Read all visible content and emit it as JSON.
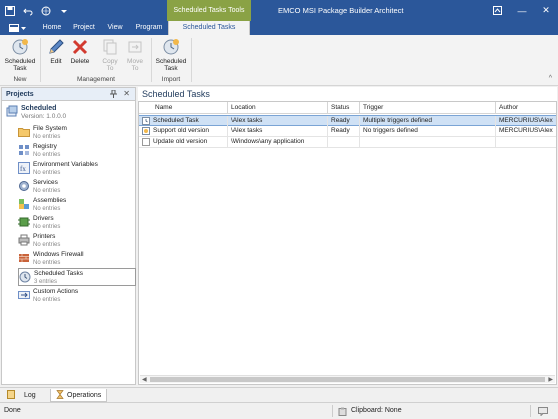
{
  "titlebar": {
    "tools_tab": "Scheduled Tasks Tools",
    "app_title": "EMCO MSI Package Builder Architect",
    "minimize_glyph": "—",
    "restore_glyph": "❐",
    "close_glyph": "✕"
  },
  "tabs": [
    {
      "label": "Home"
    },
    {
      "label": "Project"
    },
    {
      "label": "View"
    },
    {
      "label": "Program"
    },
    {
      "label": "Scheduled Tasks",
      "active": true
    }
  ],
  "ribbon": {
    "new_group": {
      "label": "New",
      "scheduled_task": "Scheduled\nTask"
    },
    "management_group": {
      "label": "Management",
      "edit": "Edit",
      "delete": "Delete",
      "copy_to": "Copy\nTo",
      "move_to": "Move\nTo"
    },
    "import_group": {
      "label": "Import",
      "scheduled_task": "Scheduled\nTask"
    },
    "collapse_glyph": "^"
  },
  "projects_pane": {
    "title": "Projects",
    "pin_glyph": "📌",
    "close_glyph": "✕",
    "root": {
      "name": "Scheduled",
      "version": "Version: 1.0.0.0"
    },
    "nodes": [
      {
        "title": "File System",
        "sub": "No entries",
        "icon": "folder-icon"
      },
      {
        "title": "Registry",
        "sub": "No entries",
        "icon": "registry-icon"
      },
      {
        "title": "Environment Variables",
        "sub": "No entries",
        "icon": "environment-icon"
      },
      {
        "title": "Services",
        "sub": "No entries",
        "icon": "services-icon"
      },
      {
        "title": "Assemblies",
        "sub": "No entries",
        "icon": "assemblies-icon"
      },
      {
        "title": "Drivers",
        "sub": "No entries",
        "icon": "drivers-icon"
      },
      {
        "title": "Printers",
        "sub": "No entries",
        "icon": "printer-icon"
      },
      {
        "title": "Windows Firewall",
        "sub": "No entries",
        "icon": "firewall-icon"
      },
      {
        "title": "Scheduled Tasks",
        "sub": "3 entries",
        "icon": "clock-icon",
        "selected": true
      },
      {
        "title": "Custom Actions",
        "sub": "No entries",
        "icon": "custom-actions-icon"
      }
    ]
  },
  "content": {
    "title": "Scheduled Tasks",
    "columns": [
      "Name",
      "Location",
      "Status",
      "Trigger",
      "Author"
    ],
    "rows": [
      {
        "name": "Scheduled Task",
        "location": "\\Alex tasks",
        "status": "Ready",
        "trigger": "Multiple triggers defined",
        "author": "MERCURIUS\\Alex",
        "selected": true
      },
      {
        "name": "Support old version",
        "location": "\\Alex tasks",
        "status": "Ready",
        "trigger": "No triggers defined",
        "author": "MERCURIUS\\Alex"
      },
      {
        "name": "Update old version",
        "location": "\\Windows\\any application",
        "status": "",
        "trigger": "",
        "author": ""
      }
    ]
  },
  "bottom_tabs": [
    {
      "label": "Log"
    },
    {
      "label": "Operations",
      "active": true
    }
  ],
  "statusbar": {
    "status": "Done",
    "clipboard": "Clipboard: None"
  }
}
